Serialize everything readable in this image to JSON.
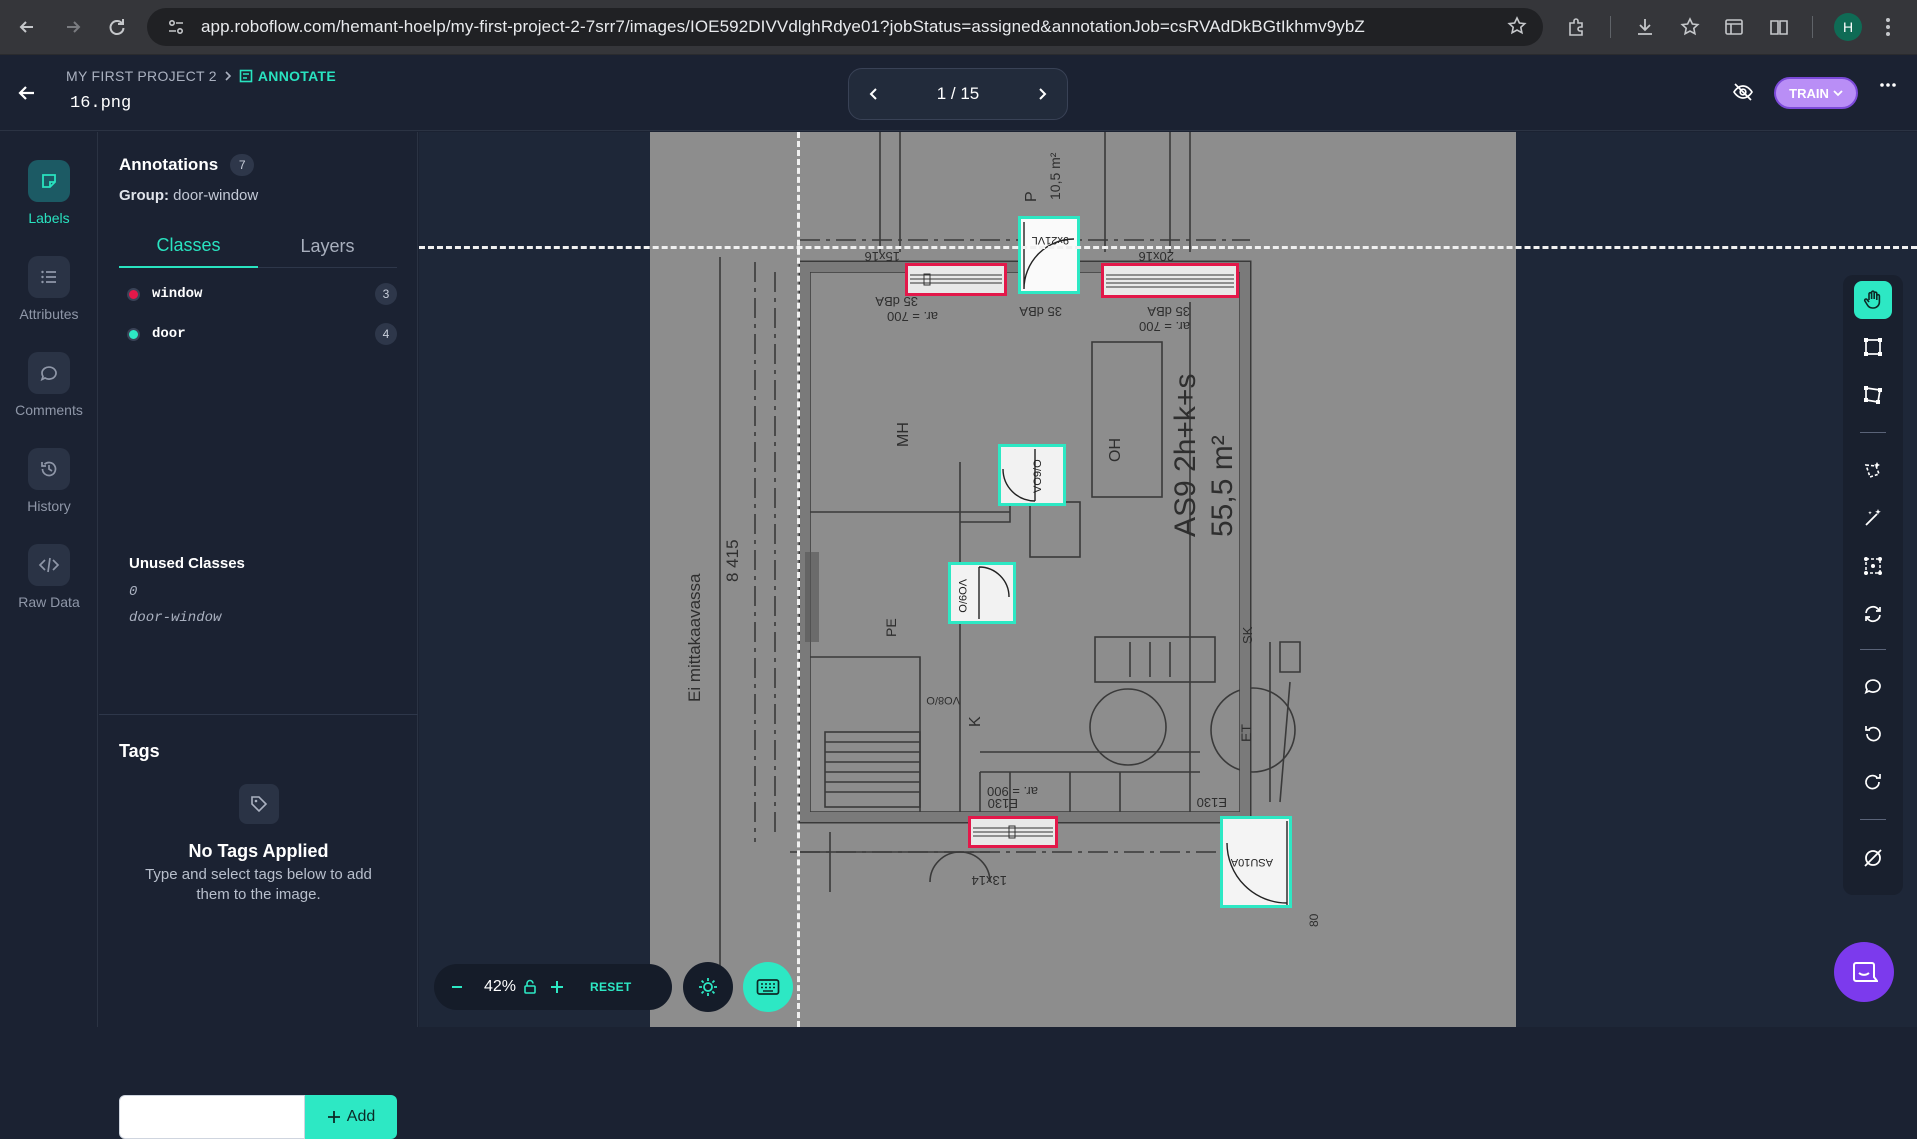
{
  "browser": {
    "url": "app.roboflow.com/hemant-hoelp/my-first-project-2-7srr7/images/IOE592DIVVdlghRdye01?jobStatus=assigned&annotationJob=csRVAdDkBGtIkhmv9ybZ",
    "profile_initial": "H"
  },
  "header": {
    "project": "MY FIRST PROJECT 2",
    "section": "ANNOTATE",
    "filename": "16.png",
    "pager": "1 / 15",
    "train_label": "TRAIN"
  },
  "iconbar": {
    "items": [
      {
        "label": "Labels",
        "icon": "label-icon",
        "active": true
      },
      {
        "label": "Attributes",
        "icon": "list-icon",
        "active": false
      },
      {
        "label": "Comments",
        "icon": "comment-icon",
        "active": false
      },
      {
        "label": "History",
        "icon": "history-icon",
        "active": false
      },
      {
        "label": "Raw Data",
        "icon": "code-icon",
        "active": false
      }
    ]
  },
  "panel": {
    "title": "Annotations",
    "count": "7",
    "group_label": "Group:",
    "group_value": "door-window",
    "tabs": [
      "Classes",
      "Layers"
    ],
    "classes": [
      {
        "name": "window",
        "count": "3",
        "color": "#e3184a"
      },
      {
        "name": "door",
        "count": "4",
        "color": "#2de8c4"
      }
    ],
    "unused_title": "Unused Classes",
    "unused": [
      "0",
      "door-window"
    ]
  },
  "tags": {
    "title": "Tags",
    "empty_title": "No Tags Applied",
    "empty_sub": "Type and select tags below to add them to the image.",
    "input_value": "",
    "add_label": "Add"
  },
  "canvas": {
    "plan_text": {
      "room_area": "AS9 2h+k+s",
      "area_value": "55,5 m²",
      "mh": "MH",
      "oh": "OH",
      "k": "K",
      "dim": "8 415",
      "side": "Ei mittakaavassa",
      "sk": "SK",
      "et": "ET",
      "p": "P",
      "p_area": "10,5 m²",
      "w1": "15x16",
      "w2": "20x16",
      "dba1": "35 dBA",
      "dba2": "35 dBA",
      "dba3": "35 dBA",
      "ar1": "ar. = 700",
      "ar2": "ar. = 700",
      "ar3": "ar. = 900",
      "e130a": "E130",
      "e130b": "E130",
      "w3": "13x14",
      "door1": "9x21VL",
      "door2": "VO9/O",
      "door3": "VO9/O",
      "door4": "ASU10A",
      "pe": "PE",
      "vo8": "VO8/O",
      "dist80": "80"
    }
  },
  "bottom": {
    "zoom": "42%",
    "reset": "RESET"
  },
  "colors": {
    "accent": "#2de8c4",
    "window": "#e3184a",
    "door": "#2de8c4",
    "train": "#b98ef6"
  }
}
